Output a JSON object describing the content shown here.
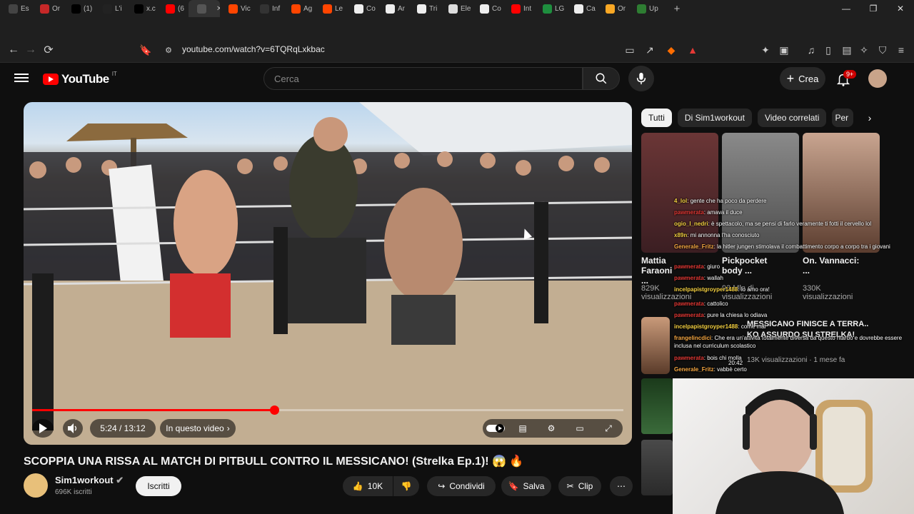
{
  "browser": {
    "tabs": [
      {
        "label": "Es",
        "icon": "chatgpt-icon",
        "color": "#444444"
      },
      {
        "label": "Or",
        "icon": "globe-icon",
        "color": "#c62828"
      },
      {
        "label": "(1)",
        "icon": "x-icon",
        "color": "#000000"
      },
      {
        "label": "L'i",
        "icon": "g-icon",
        "color": "#222222"
      },
      {
        "label": "x.c",
        "icon": "x-icon",
        "color": "#000000"
      },
      {
        "label": "(6",
        "icon": "youtube-icon",
        "color": "#ff0000"
      },
      {
        "label": "",
        "icon": "blank-icon",
        "color": "#555555"
      },
      {
        "label": "Vic",
        "icon": "reddit-icon",
        "color": "#ff4500"
      },
      {
        "label": "Inf",
        "icon": "generic-icon",
        "color": "#333333"
      },
      {
        "label": "Ag",
        "icon": "reddit-icon",
        "color": "#ff4500"
      },
      {
        "label": "Le",
        "icon": "reddit-icon",
        "color": "#ff4500"
      },
      {
        "label": "Co",
        "icon": "wikipedia-icon",
        "color": "#eeeeee"
      },
      {
        "label": "Ar",
        "icon": "wikipedia-icon",
        "color": "#eeeeee"
      },
      {
        "label": "Tri",
        "icon": "wikipedia-icon",
        "color": "#eeeeee"
      },
      {
        "label": "Ele",
        "icon": "doc-icon",
        "color": "#dddddd"
      },
      {
        "label": "Co",
        "icon": "wikipedia-icon",
        "color": "#eeeeee"
      },
      {
        "label": "Int",
        "icon": "youtube-icon",
        "color": "#ff0000"
      },
      {
        "label": "LG",
        "icon": "sheet-icon",
        "color": "#1e8e3e"
      },
      {
        "label": "Ca",
        "icon": "wikipedia-icon",
        "color": "#eeeeee"
      },
      {
        "label": "Or",
        "icon": "globe-icon",
        "color": "#f9a825"
      },
      {
        "label": "Up",
        "icon": "play-icon",
        "color": "#2e7d32"
      }
    ],
    "new_tab": "+",
    "url": "youtube.com/watch?v=6TQRqLxkbac"
  },
  "youtube": {
    "logo": "YouTube",
    "country": "IT",
    "search_placeholder": "Cerca",
    "create_label": "Crea",
    "notif_count": "9+"
  },
  "video": {
    "time": "5:24 / 13:12",
    "chapter": "In questo video",
    "progress_fraction": 0.409,
    "title": "SCOPPIA UNA RISSA AL MATCH DI PITBULL CONTRO IL MESSICANO! (Strelka Ep.1)! 😱 🔥",
    "channel": "Sim1workout",
    "subscribers": "696K iscritti",
    "subscribe_label": "Iscritti",
    "likes": "10K",
    "share_label": "Condividi",
    "save_label": "Salva",
    "clip_label": "Clip"
  },
  "sidebar": {
    "chips": [
      "Tutti",
      "Di Sim1workout",
      "Video correlati",
      "Per"
    ],
    "shorts": [
      {
        "title": "Mattia Faraoni ...",
        "views": "829K visualizzazioni"
      },
      {
        "title": "Pickpocket body ...",
        "views": "93 Mln di visualizzazioni"
      },
      {
        "title": "On. Vannacci: ...",
        "views": "330K visualizzazioni"
      }
    ],
    "recommended": {
      "title": "MESSICANO FINISCE A TERRA.. KO ASSURDO SU STRELKA!",
      "meta": "13K visualizzazioni · 1 mese fa"
    }
  },
  "chat": [
    {
      "user": "4_lol",
      "msg": "gente che ha poco da perdere",
      "color": "#f5d142"
    },
    {
      "user": "pawmerata",
      "msg": "amava il duce",
      "color": "#e53935"
    },
    {
      "user": "ogio_l_nedri",
      "msg": "è spettacolo, ma se pensi di farlo veramente ti fotti il cervello lol",
      "color": "#f5d142"
    },
    {
      "user": "x89n",
      "msg": "mi annonna l'ha conosciuto",
      "color": "#f5d142"
    },
    {
      "user": "Generale_Fritz",
      "msg": "la hitler jungen stimolava il combattimento corpo a corpo tra i giovani",
      "color": "#f5a742"
    },
    {
      "user": "pawmerata",
      "msg": "giuro",
      "color": "#e53935"
    },
    {
      "user": "pawmerata",
      "msg": "wallah",
      "color": "#e53935"
    },
    {
      "user": "incelpapistgroyper1488",
      "msg": "lo amo ora!",
      "color": "#f5d142"
    },
    {
      "user": "pawmerata",
      "msg": "cattolico",
      "color": "#e53935"
    },
    {
      "user": "pawmerata",
      "msg": "pure la chiesa lo odiava",
      "color": "#e53935"
    },
    {
      "user": "incelpapistgroyper1488",
      "msg": "come mai",
      "color": "#f5d142"
    },
    {
      "user": "frangelincdici",
      "msg": "Che era un'attività totalmente diversa da questo ritardo e dovrebbe essere inclusa nel curriculum scolastico",
      "color": "#f5a742"
    },
    {
      "user": "pawmerata",
      "msg": "bois chi molla",
      "color": "#e53935"
    },
    {
      "user": "Generale_Fritz",
      "msg": "vabbè certo",
      "color": "#f5a742"
    }
  ],
  "overlay_time": "20:42",
  "colors": {
    "accent": "#ff0000",
    "bg": "#0f0f0f",
    "chip_bg": "#272727"
  }
}
